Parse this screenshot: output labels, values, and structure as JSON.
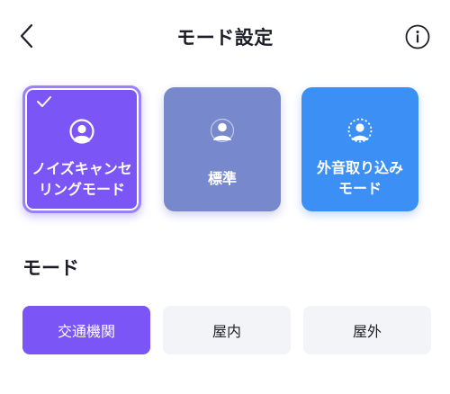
{
  "header": {
    "title": "モード設定",
    "back_icon": "chevron-left-icon",
    "info_icon": "info-circle-icon"
  },
  "mode_cards": [
    {
      "label": "ノイズキャンセ\nリングモード",
      "selected": true,
      "color": "#7b55f5",
      "icon": "noise-cancel-person-icon"
    },
    {
      "label": "標準",
      "selected": false,
      "color": "#7789cc",
      "icon": "standard-person-icon"
    },
    {
      "label": "外音取り込み\nモード",
      "selected": false,
      "color": "#3b8ff5",
      "icon": "ambient-person-icon"
    }
  ],
  "mode_section": {
    "title": "モード",
    "options": [
      {
        "label": "交通機関",
        "selected": true
      },
      {
        "label": "屋内",
        "selected": false
      },
      {
        "label": "屋外",
        "selected": false
      }
    ]
  },
  "colors": {
    "accent": "#7b55f5",
    "segment_idle_bg": "#f3f4f8"
  }
}
